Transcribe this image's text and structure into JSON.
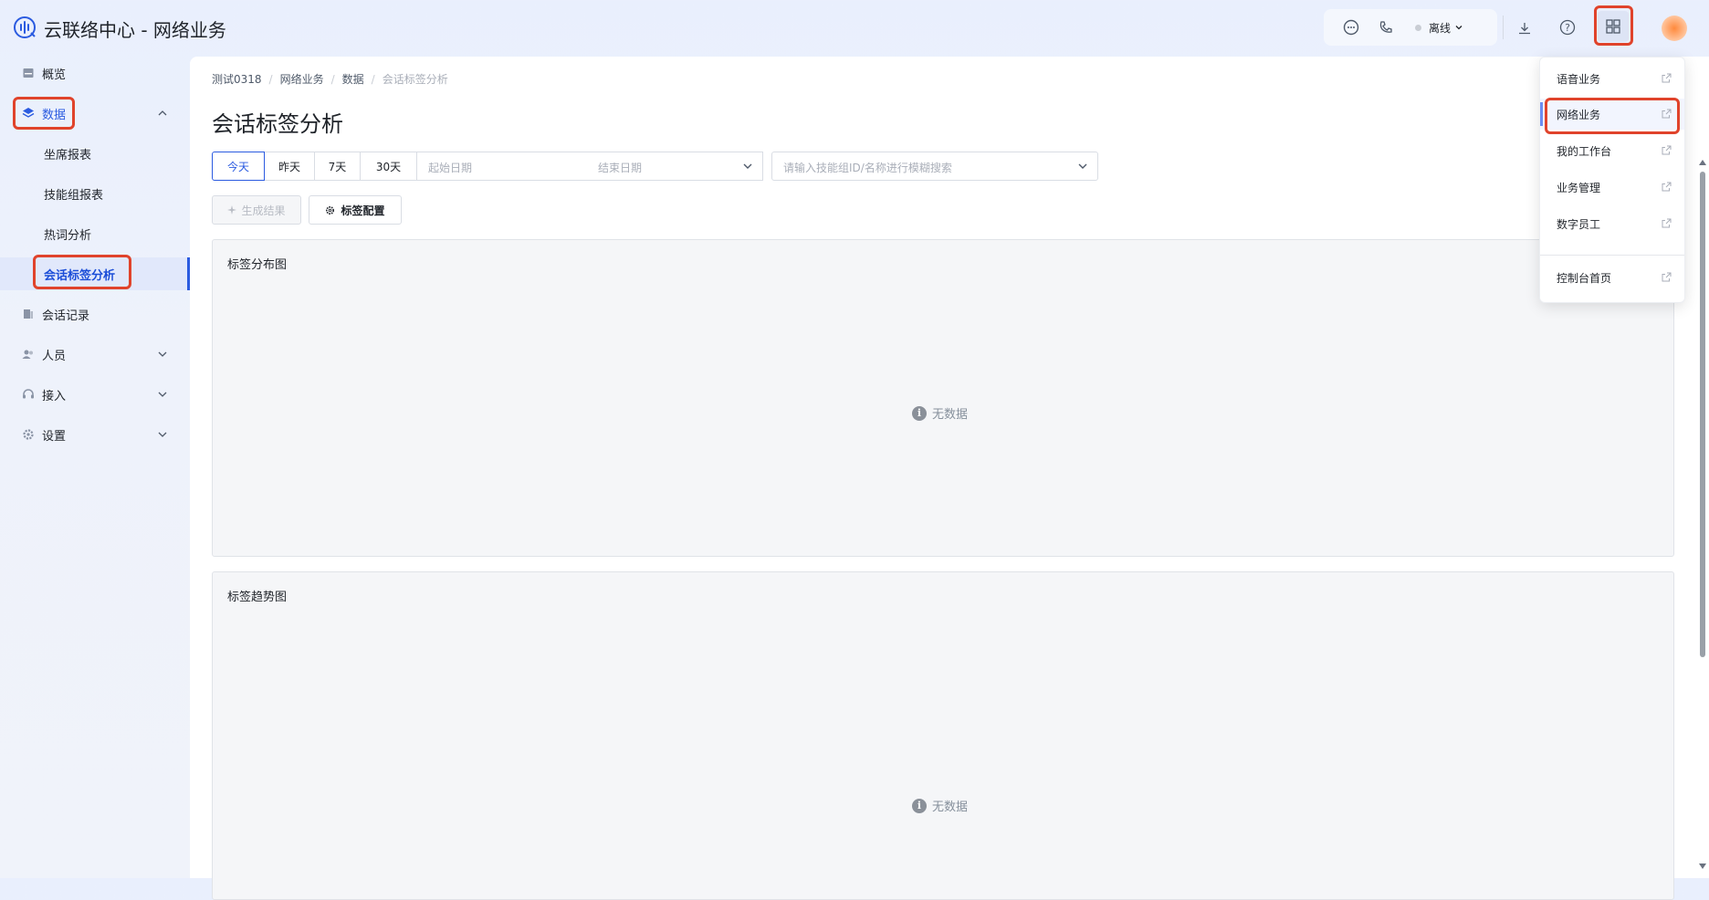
{
  "header": {
    "app_title": "云联络中心 - 网络业务",
    "status_label": "离线",
    "icons": [
      "message-icon",
      "phone-icon",
      "download-icon",
      "help-icon",
      "apps-grid-icon"
    ]
  },
  "sidebar": {
    "items": [
      {
        "label": "概览",
        "icon": "overview-icon"
      },
      {
        "label": "数据",
        "icon": "layers-icon",
        "expanded": true
      },
      {
        "label": "会话记录",
        "icon": "records-icon"
      },
      {
        "label": "人员",
        "icon": "users-icon"
      },
      {
        "label": "接入",
        "icon": "headset-icon"
      },
      {
        "label": "设置",
        "icon": "gear-icon"
      }
    ],
    "data_children": [
      "坐席报表",
      "技能组报表",
      "热词分析",
      "会话标签分析"
    ]
  },
  "breadcrumb": [
    "测试0318",
    "网络业务",
    "数据",
    "会话标签分析"
  ],
  "page": {
    "title": "会话标签分析",
    "date_presets": [
      "今天",
      "昨天",
      "7天",
      "30天"
    ],
    "active_preset": "今天",
    "start_date_placeholder": "起始日期",
    "end_date_placeholder": "结束日期",
    "search_placeholder": "请输入技能组ID/名称进行模糊搜索",
    "generate_button": "生成结果",
    "tag_config_button": "标签配置",
    "panels": [
      {
        "title": "标签分布图",
        "empty_text": "无数据"
      },
      {
        "title": "标签趋势图",
        "empty_text": "无数据"
      }
    ]
  },
  "dropdown": {
    "items": [
      "语音业务",
      "网络业务",
      "我的工作台",
      "业务管理",
      "数字员工",
      "控制台首页"
    ],
    "active": "网络业务"
  },
  "colors": {
    "accent": "#2b5be0",
    "highlight_border": "#e0432b"
  }
}
